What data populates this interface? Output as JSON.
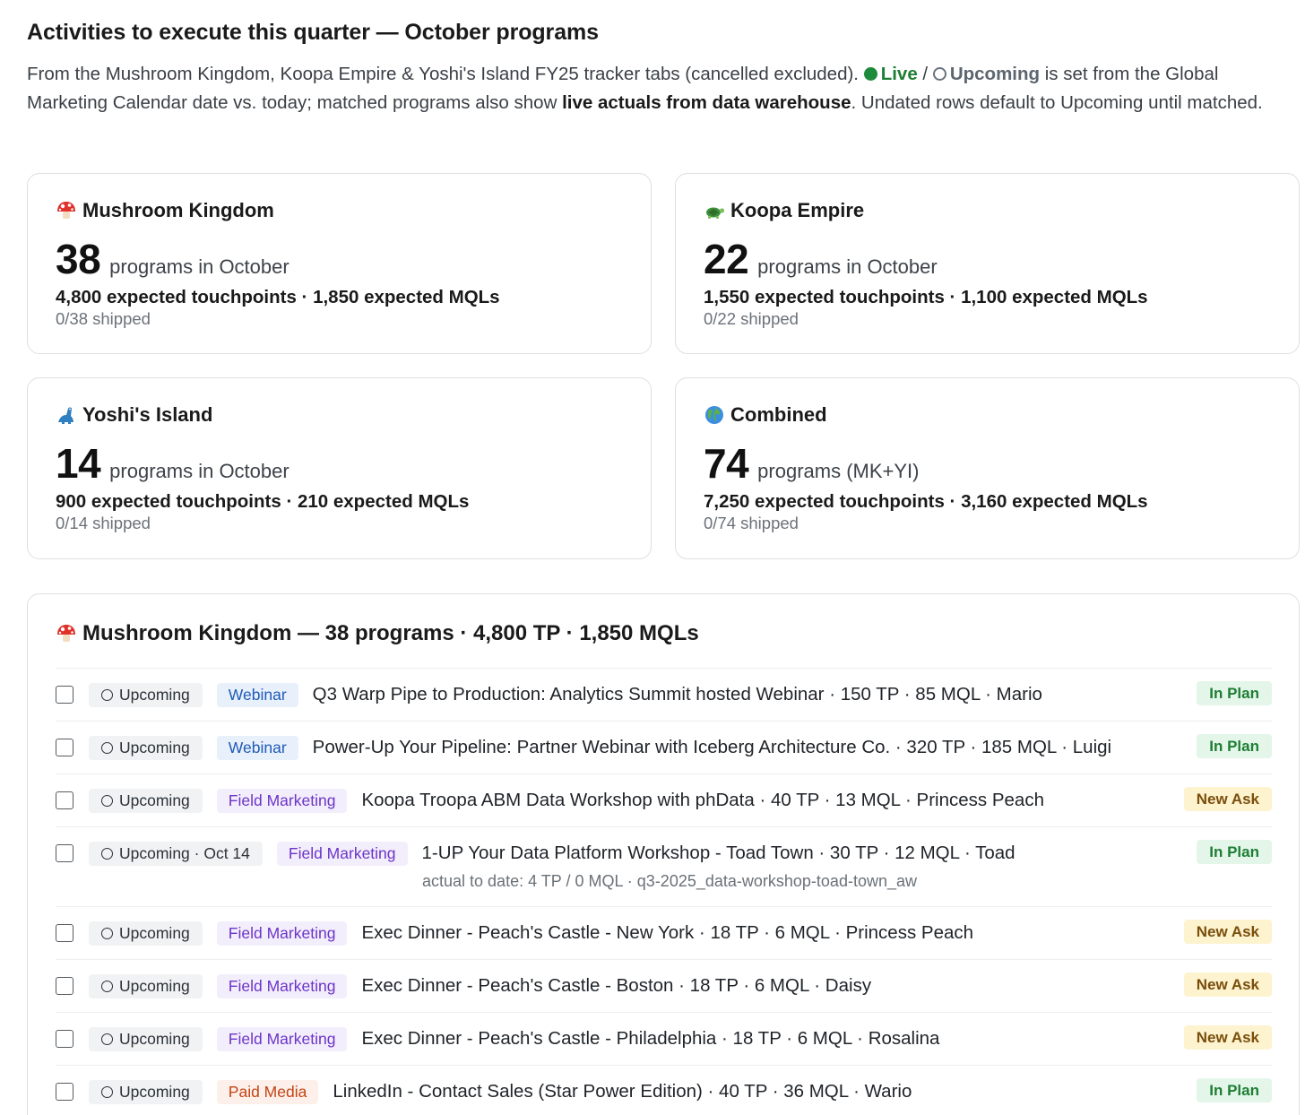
{
  "title": "Activities to execute this quarter — October programs",
  "intro": {
    "part1": "From the Mushroom Kingdom, Koopa Empire & Yoshi's Island FY25 tracker tabs (cancelled excluded). ",
    "live_label": "Live",
    "sep": " / ",
    "upcoming_label": "Upcoming",
    "part2": " is set from the Global Marketing Calendar date vs. today; matched programs also show ",
    "bold": "live actuals from data warehouse",
    "part3": ". Undated rows default to Upcoming until matched."
  },
  "cards": [
    {
      "name": "Mushroom Kingdom",
      "icon": "mushroom-icon",
      "count": "38",
      "count_label": "programs in October",
      "expected": "4,800 expected touchpoints · 1,850 expected MQLs",
      "shipped": "0/38 shipped"
    },
    {
      "name": "Koopa Empire",
      "icon": "turtle-icon",
      "count": "22",
      "count_label": "programs in October",
      "expected": "1,550 expected touchpoints · 1,100 expected MQLs",
      "shipped": "0/22 shipped"
    },
    {
      "name": "Yoshi's Island",
      "icon": "dinosaur-icon",
      "count": "14",
      "count_label": "programs in October",
      "expected": "900 expected touchpoints · 210 expected MQLs",
      "shipped": "0/14 shipped"
    },
    {
      "name": "Combined",
      "icon": "globe-icon",
      "count": "74",
      "count_label": "programs (MK+YI)",
      "expected": "7,250 expected touchpoints · 3,160 expected MQLs",
      "shipped": "0/74 shipped"
    }
  ],
  "panel": {
    "icon": "mushroom-icon",
    "title": "Mushroom Kingdom — 38 programs · 4,800 TP · 1,850 MQLs",
    "rows": [
      {
        "status": "Upcoming",
        "type": "Webinar",
        "type_kind": "webinar",
        "desc": "Q3 Warp Pipe to Production: Analytics Summit hosted Webinar · 150 TP · 85 MQL · Mario",
        "plan": "In Plan",
        "plan_kind": "inplan",
        "sub": ""
      },
      {
        "status": "Upcoming",
        "type": "Webinar",
        "type_kind": "webinar",
        "desc": "Power-Up Your Pipeline: Partner Webinar with Iceberg Architecture Co. · 320 TP · 185 MQL · Luigi",
        "plan": "In Plan",
        "plan_kind": "inplan",
        "sub": ""
      },
      {
        "status": "Upcoming",
        "type": "Field Marketing",
        "type_kind": "field",
        "desc": "Koopa Troopa ABM Data Workshop with phData · 40 TP · 13 MQL · Princess Peach",
        "plan": "New Ask",
        "plan_kind": "newask",
        "sub": ""
      },
      {
        "status": "Upcoming · Oct 14",
        "type": "Field Marketing",
        "type_kind": "field",
        "desc": "1-UP Your Data Platform Workshop - Toad Town · 30 TP · 12 MQL · Toad",
        "plan": "In Plan",
        "plan_kind": "inplan",
        "sub": "actual to date: 4 TP / 0 MQL · q3-2025_data-workshop-toad-town_aw"
      },
      {
        "status": "Upcoming",
        "type": "Field Marketing",
        "type_kind": "field",
        "desc": "Exec Dinner - Peach's Castle - New York · 18 TP · 6 MQL · Princess Peach",
        "plan": "New Ask",
        "plan_kind": "newask",
        "sub": ""
      },
      {
        "status": "Upcoming",
        "type": "Field Marketing",
        "type_kind": "field",
        "desc": "Exec Dinner - Peach's Castle - Boston · 18 TP · 6 MQL · Daisy",
        "plan": "New Ask",
        "plan_kind": "newask",
        "sub": ""
      },
      {
        "status": "Upcoming",
        "type": "Field Marketing",
        "type_kind": "field",
        "desc": "Exec Dinner - Peach's Castle - Philadelphia · 18 TP · 6 MQL · Rosalina",
        "plan": "New Ask",
        "plan_kind": "newask",
        "sub": ""
      },
      {
        "status": "Upcoming",
        "type": "Paid Media",
        "type_kind": "paid",
        "desc": "LinkedIn - Contact Sales (Star Power Edition) · 40 TP · 36 MQL · Wario",
        "plan": "In Plan",
        "plan_kind": "inplan",
        "sub": ""
      }
    ]
  }
}
